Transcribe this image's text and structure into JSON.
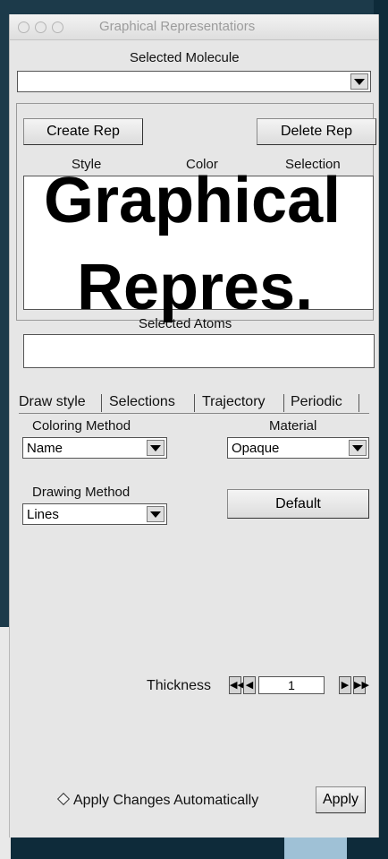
{
  "window": {
    "title": "Graphical Representatiors"
  },
  "selected_molecule": {
    "label": "Selected Molecule",
    "value": ""
  },
  "reps": {
    "create_label": "Create Rep",
    "delete_label": "Delete Rep",
    "columns": [
      "Style",
      "Color",
      "Selection"
    ],
    "overlay_line1": "Graphical",
    "overlay_line2": "Repres."
  },
  "selected_atoms": {
    "label": "Selected Atoms",
    "value": ""
  },
  "tabs": [
    {
      "label": "Draw style"
    },
    {
      "label": "Selections"
    },
    {
      "label": "Trajectory"
    },
    {
      "label": "Periodic"
    }
  ],
  "draw_style": {
    "coloring_label": "Coloring Method",
    "coloring_value": "Name",
    "material_label": "Material",
    "material_value": "Opaque",
    "drawing_label": "Drawing Method",
    "drawing_value": "Lines",
    "default_label": "Default",
    "thickness_label": "Thickness",
    "thickness_value": "1"
  },
  "footer": {
    "auto_apply_label": "Apply Changes Automatically",
    "apply_label": "Apply"
  }
}
